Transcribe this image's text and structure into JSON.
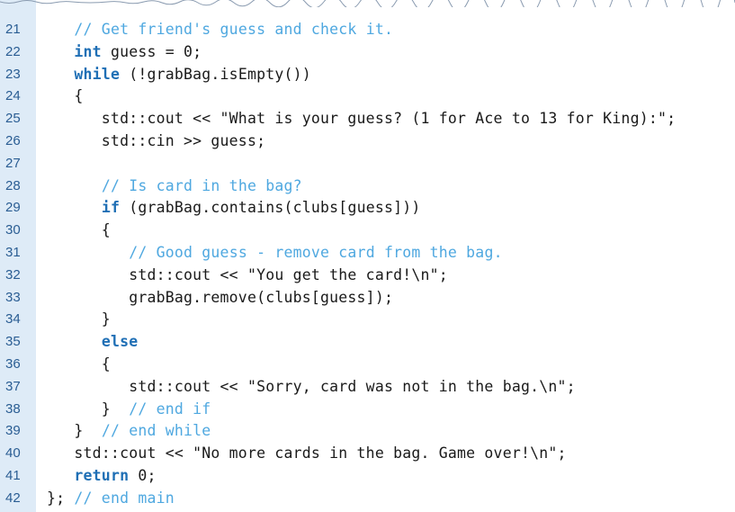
{
  "colors": {
    "gutter_background": "#deebf7",
    "line_number": "#2a5d93",
    "keyword": "#1f6fb5",
    "comment": "#4fa8e0",
    "plain": "#1a1a1a"
  },
  "lines": [
    {
      "number": "21",
      "tokens": [
        {
          "text": "   ",
          "kind": "plain"
        },
        {
          "text": "// Get friend's guess and check it.",
          "kind": "comment"
        }
      ]
    },
    {
      "number": "22",
      "tokens": [
        {
          "text": "   ",
          "kind": "plain"
        },
        {
          "text": "int",
          "kind": "keyword"
        },
        {
          "text": " guess = 0;",
          "kind": "plain"
        }
      ]
    },
    {
      "number": "23",
      "tokens": [
        {
          "text": "   ",
          "kind": "plain"
        },
        {
          "text": "while",
          "kind": "keyword"
        },
        {
          "text": " (!grabBag.isEmpty())",
          "kind": "plain"
        }
      ]
    },
    {
      "number": "24",
      "tokens": [
        {
          "text": "   {",
          "kind": "plain"
        }
      ]
    },
    {
      "number": "25",
      "tokens": [
        {
          "text": "      std::cout << \"What is your guess? (1 for Ace to 13 for King):\";",
          "kind": "plain"
        }
      ]
    },
    {
      "number": "26",
      "tokens": [
        {
          "text": "      std::cin >> guess;",
          "kind": "plain"
        }
      ]
    },
    {
      "number": "27",
      "tokens": []
    },
    {
      "number": "28",
      "tokens": [
        {
          "text": "      ",
          "kind": "plain"
        },
        {
          "text": "// Is card in the bag?",
          "kind": "comment"
        }
      ]
    },
    {
      "number": "29",
      "tokens": [
        {
          "text": "      ",
          "kind": "plain"
        },
        {
          "text": "if",
          "kind": "keyword"
        },
        {
          "text": " (grabBag.contains(clubs[guess]))",
          "kind": "plain"
        }
      ]
    },
    {
      "number": "30",
      "tokens": [
        {
          "text": "      {",
          "kind": "plain"
        }
      ]
    },
    {
      "number": "31",
      "tokens": [
        {
          "text": "         ",
          "kind": "plain"
        },
        {
          "text": "// Good guess - remove card from the bag.",
          "kind": "comment"
        }
      ]
    },
    {
      "number": "32",
      "tokens": [
        {
          "text": "         std::cout << \"You get the card!\\n\";",
          "kind": "plain"
        }
      ]
    },
    {
      "number": "33",
      "tokens": [
        {
          "text": "         grabBag.remove(clubs[guess]);",
          "kind": "plain"
        }
      ]
    },
    {
      "number": "34",
      "tokens": [
        {
          "text": "      }",
          "kind": "plain"
        }
      ]
    },
    {
      "number": "35",
      "tokens": [
        {
          "text": "      ",
          "kind": "plain"
        },
        {
          "text": "else",
          "kind": "keyword"
        }
      ]
    },
    {
      "number": "36",
      "tokens": [
        {
          "text": "      {",
          "kind": "plain"
        }
      ]
    },
    {
      "number": "37",
      "tokens": [
        {
          "text": "         std::cout << \"Sorry, card was not in the bag.\\n\";",
          "kind": "plain"
        }
      ]
    },
    {
      "number": "38",
      "tokens": [
        {
          "text": "      }  ",
          "kind": "plain"
        },
        {
          "text": "// end if",
          "kind": "comment"
        }
      ]
    },
    {
      "number": "39",
      "tokens": [
        {
          "text": "   }  ",
          "kind": "plain"
        },
        {
          "text": "// end while",
          "kind": "comment"
        }
      ]
    },
    {
      "number": "40",
      "tokens": [
        {
          "text": "   std::cout << \"No more cards in the bag. Game over!\\n\";",
          "kind": "plain"
        }
      ]
    },
    {
      "number": "41",
      "tokens": [
        {
          "text": "   ",
          "kind": "plain"
        },
        {
          "text": "return",
          "kind": "keyword"
        },
        {
          "text": " 0;",
          "kind": "plain"
        }
      ]
    },
    {
      "number": "42",
      "tokens": [
        {
          "text": "}; ",
          "kind": "plain"
        },
        {
          "text": "// end main",
          "kind": "comment"
        }
      ]
    }
  ]
}
